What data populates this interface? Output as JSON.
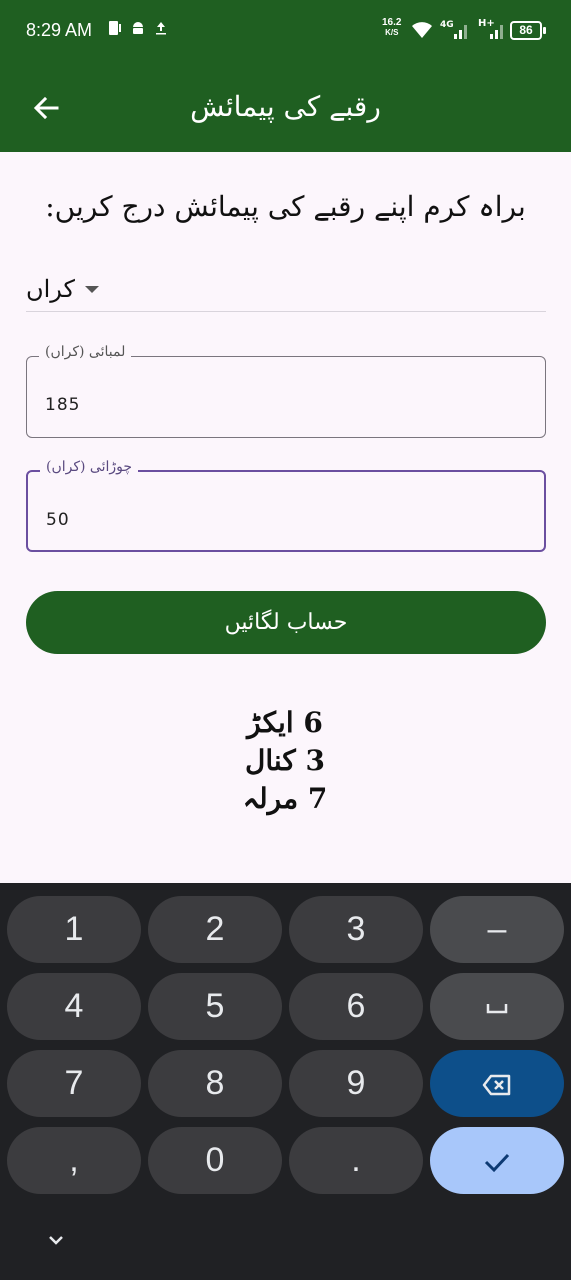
{
  "status_bar": {
    "time": "8:29 AM",
    "net_speed_value": "16.2",
    "net_speed_unit": "K/S",
    "network_4g": "4G",
    "network_hplus": "H+",
    "battery": "86"
  },
  "app_bar": {
    "title": "رقبے کی پیمائش",
    "back_icon": "arrow-left-icon"
  },
  "form": {
    "instruction": "براہ کرم اپنے رقبے کی پیمائش درج کریں:",
    "unit_selected": "کراں",
    "length_label": "لمبائی (کراں)",
    "length_value": "185",
    "width_label": "چوڑائی (کراں)",
    "width_value": "50",
    "calculate_label": "حساب لگائیں"
  },
  "results": {
    "acres": "6 ایکڑ",
    "kanal": "3 کنال",
    "marla": "7 مرلہ"
  },
  "keyboard": {
    "keys": [
      "1",
      "2",
      "3",
      "–",
      "4",
      "5",
      "6",
      "␣",
      "7",
      "8",
      "9",
      "⌫",
      ",",
      "0",
      ".",
      "✓"
    ]
  },
  "colors": {
    "primary": "#1f5f21",
    "background": "#fcf6fc",
    "focus": "#6b4fa0",
    "keyboard_bg": "#202124"
  }
}
